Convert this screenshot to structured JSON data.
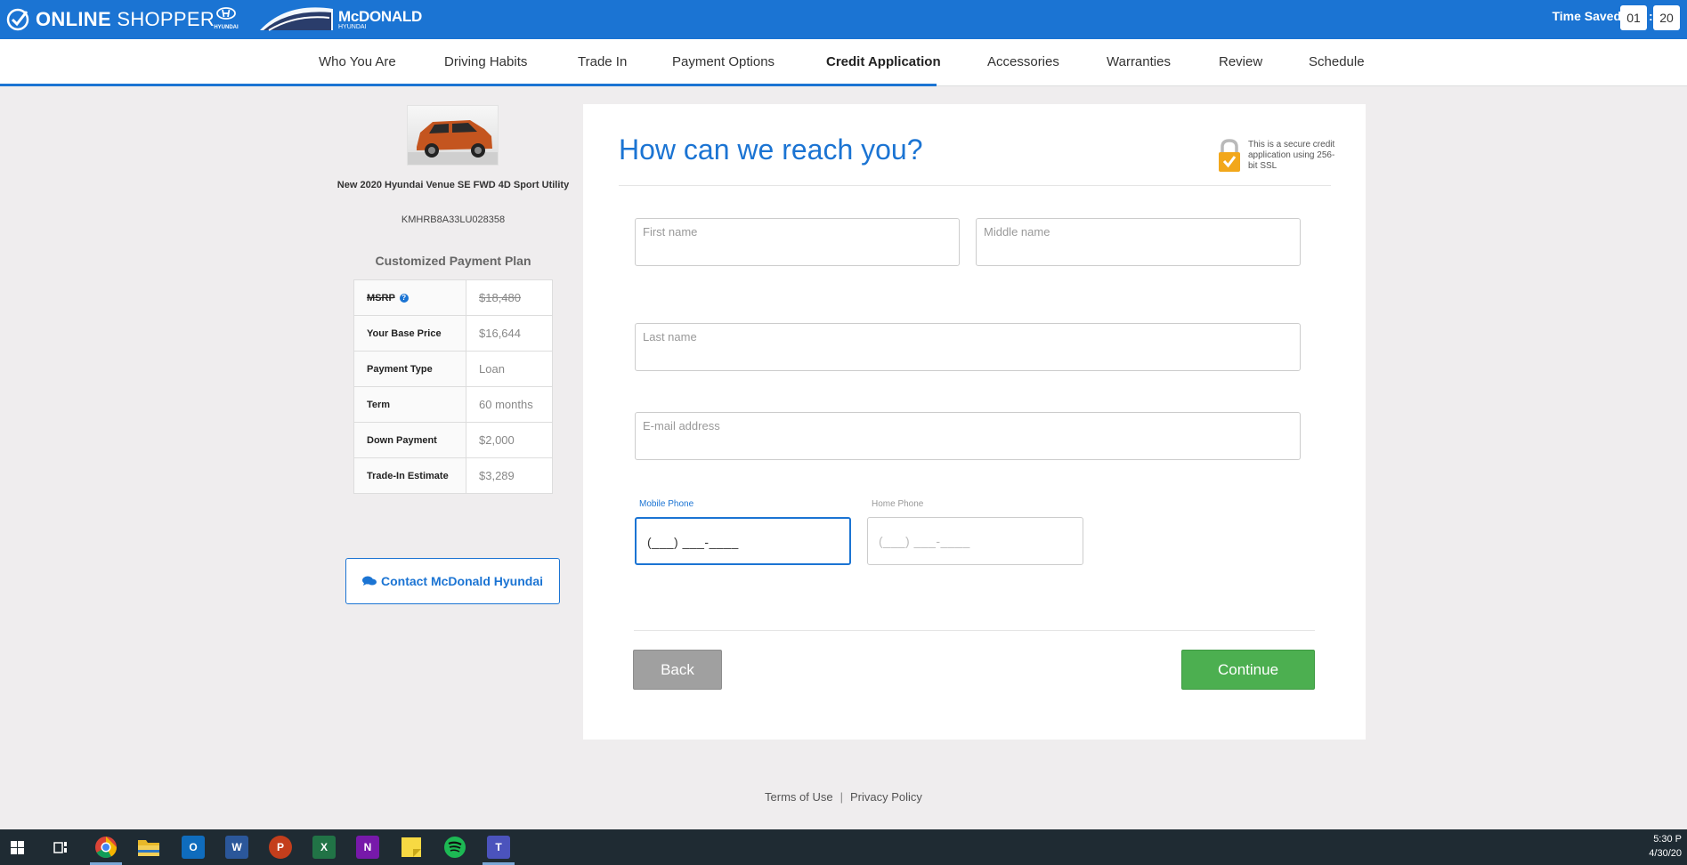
{
  "header": {
    "brand_bold": "ONLINE",
    "brand_thin": "SHOPPER",
    "hyundai_word": "HYUNDAI",
    "dealer_name": "McDONALD",
    "dealer_sub": "HYUNDAI",
    "time_saved_label": "Time Saved",
    "time_hours": "01",
    "time_sep": ":",
    "time_minutes": "20"
  },
  "nav": {
    "items": [
      {
        "label": "Who You Are"
      },
      {
        "label": "Driving Habits"
      },
      {
        "label": "Trade In"
      },
      {
        "label": "Payment Options"
      },
      {
        "label": "Credit Application",
        "active": true
      },
      {
        "label": "Accessories"
      },
      {
        "label": "Warranties"
      },
      {
        "label": "Review"
      },
      {
        "label": "Schedule"
      }
    ]
  },
  "vehicle": {
    "name": "New 2020 Hyundai Venue SE FWD 4D Sport Utility",
    "vin": "KMHRB8A33LU028358",
    "color": "#c4551f"
  },
  "plan": {
    "title": "Customized Payment Plan",
    "rows": [
      {
        "label": "MSRP",
        "value": "$18,480",
        "help": "?"
      },
      {
        "label": "Your Base Price",
        "value": "$16,644"
      },
      {
        "label": "Payment Type",
        "value": "Loan"
      },
      {
        "label": "Term",
        "value": "60 months"
      },
      {
        "label": "Down Payment",
        "value": "$2,000"
      },
      {
        "label": "Trade-In Estimate",
        "value": "$3,289"
      }
    ]
  },
  "contact": {
    "label": "Contact McDonald Hyundai"
  },
  "form": {
    "heading": "How can we reach you?",
    "secure_text": "This is a secure credit application using 256-bit SSL",
    "first_name": {
      "placeholder": "First name",
      "value": ""
    },
    "middle_name": {
      "placeholder": "Middle name",
      "value": ""
    },
    "last_name": {
      "placeholder": "Last name",
      "value": ""
    },
    "email": {
      "placeholder": "E-mail address",
      "value": ""
    },
    "mobile_phone": {
      "label": "Mobile Phone",
      "mask": "(___) ___-____"
    },
    "home_phone": {
      "label": "Home Phone",
      "mask": "(___) ___-____"
    },
    "back_label": "Back",
    "continue_label": "Continue"
  },
  "footer": {
    "terms": "Terms of Use",
    "sep": "|",
    "privacy": "Privacy Policy"
  },
  "taskbar": {
    "apps": [
      {
        "name": "windows-start-icon",
        "glyph": "",
        "color": "#1f2b33"
      },
      {
        "name": "task-view-icon",
        "glyph": "",
        "color": "#1f2b33"
      },
      {
        "name": "chrome-icon",
        "glyph": "",
        "color": "#1f2b33",
        "active": true
      },
      {
        "name": "file-explorer-icon",
        "glyph": "",
        "color": "#e8b829"
      },
      {
        "name": "outlook-icon",
        "glyph": "O",
        "color": "#0f6cbd"
      },
      {
        "name": "word-icon",
        "glyph": "W",
        "color": "#2b579a"
      },
      {
        "name": "powerpoint-icon",
        "glyph": "P",
        "color": "#c43e1c"
      },
      {
        "name": "excel-icon",
        "glyph": "X",
        "color": "#217346"
      },
      {
        "name": "onenote-icon",
        "glyph": "N",
        "color": "#7719aa"
      },
      {
        "name": "sticky-notes-icon",
        "glyph": "",
        "color": "#f7d943"
      },
      {
        "name": "spotify-icon",
        "glyph": "",
        "color": "#1db954"
      },
      {
        "name": "teams-icon",
        "glyph": "T",
        "color": "#4b53bc"
      }
    ],
    "time": "5:30 P",
    "date": "4/30/20"
  },
  "colors": {
    "brand_blue": "#1b74d3",
    "continue_green": "#4caf50",
    "back_gray": "#a0a0a0",
    "lock_orange": "#f2a71b"
  }
}
